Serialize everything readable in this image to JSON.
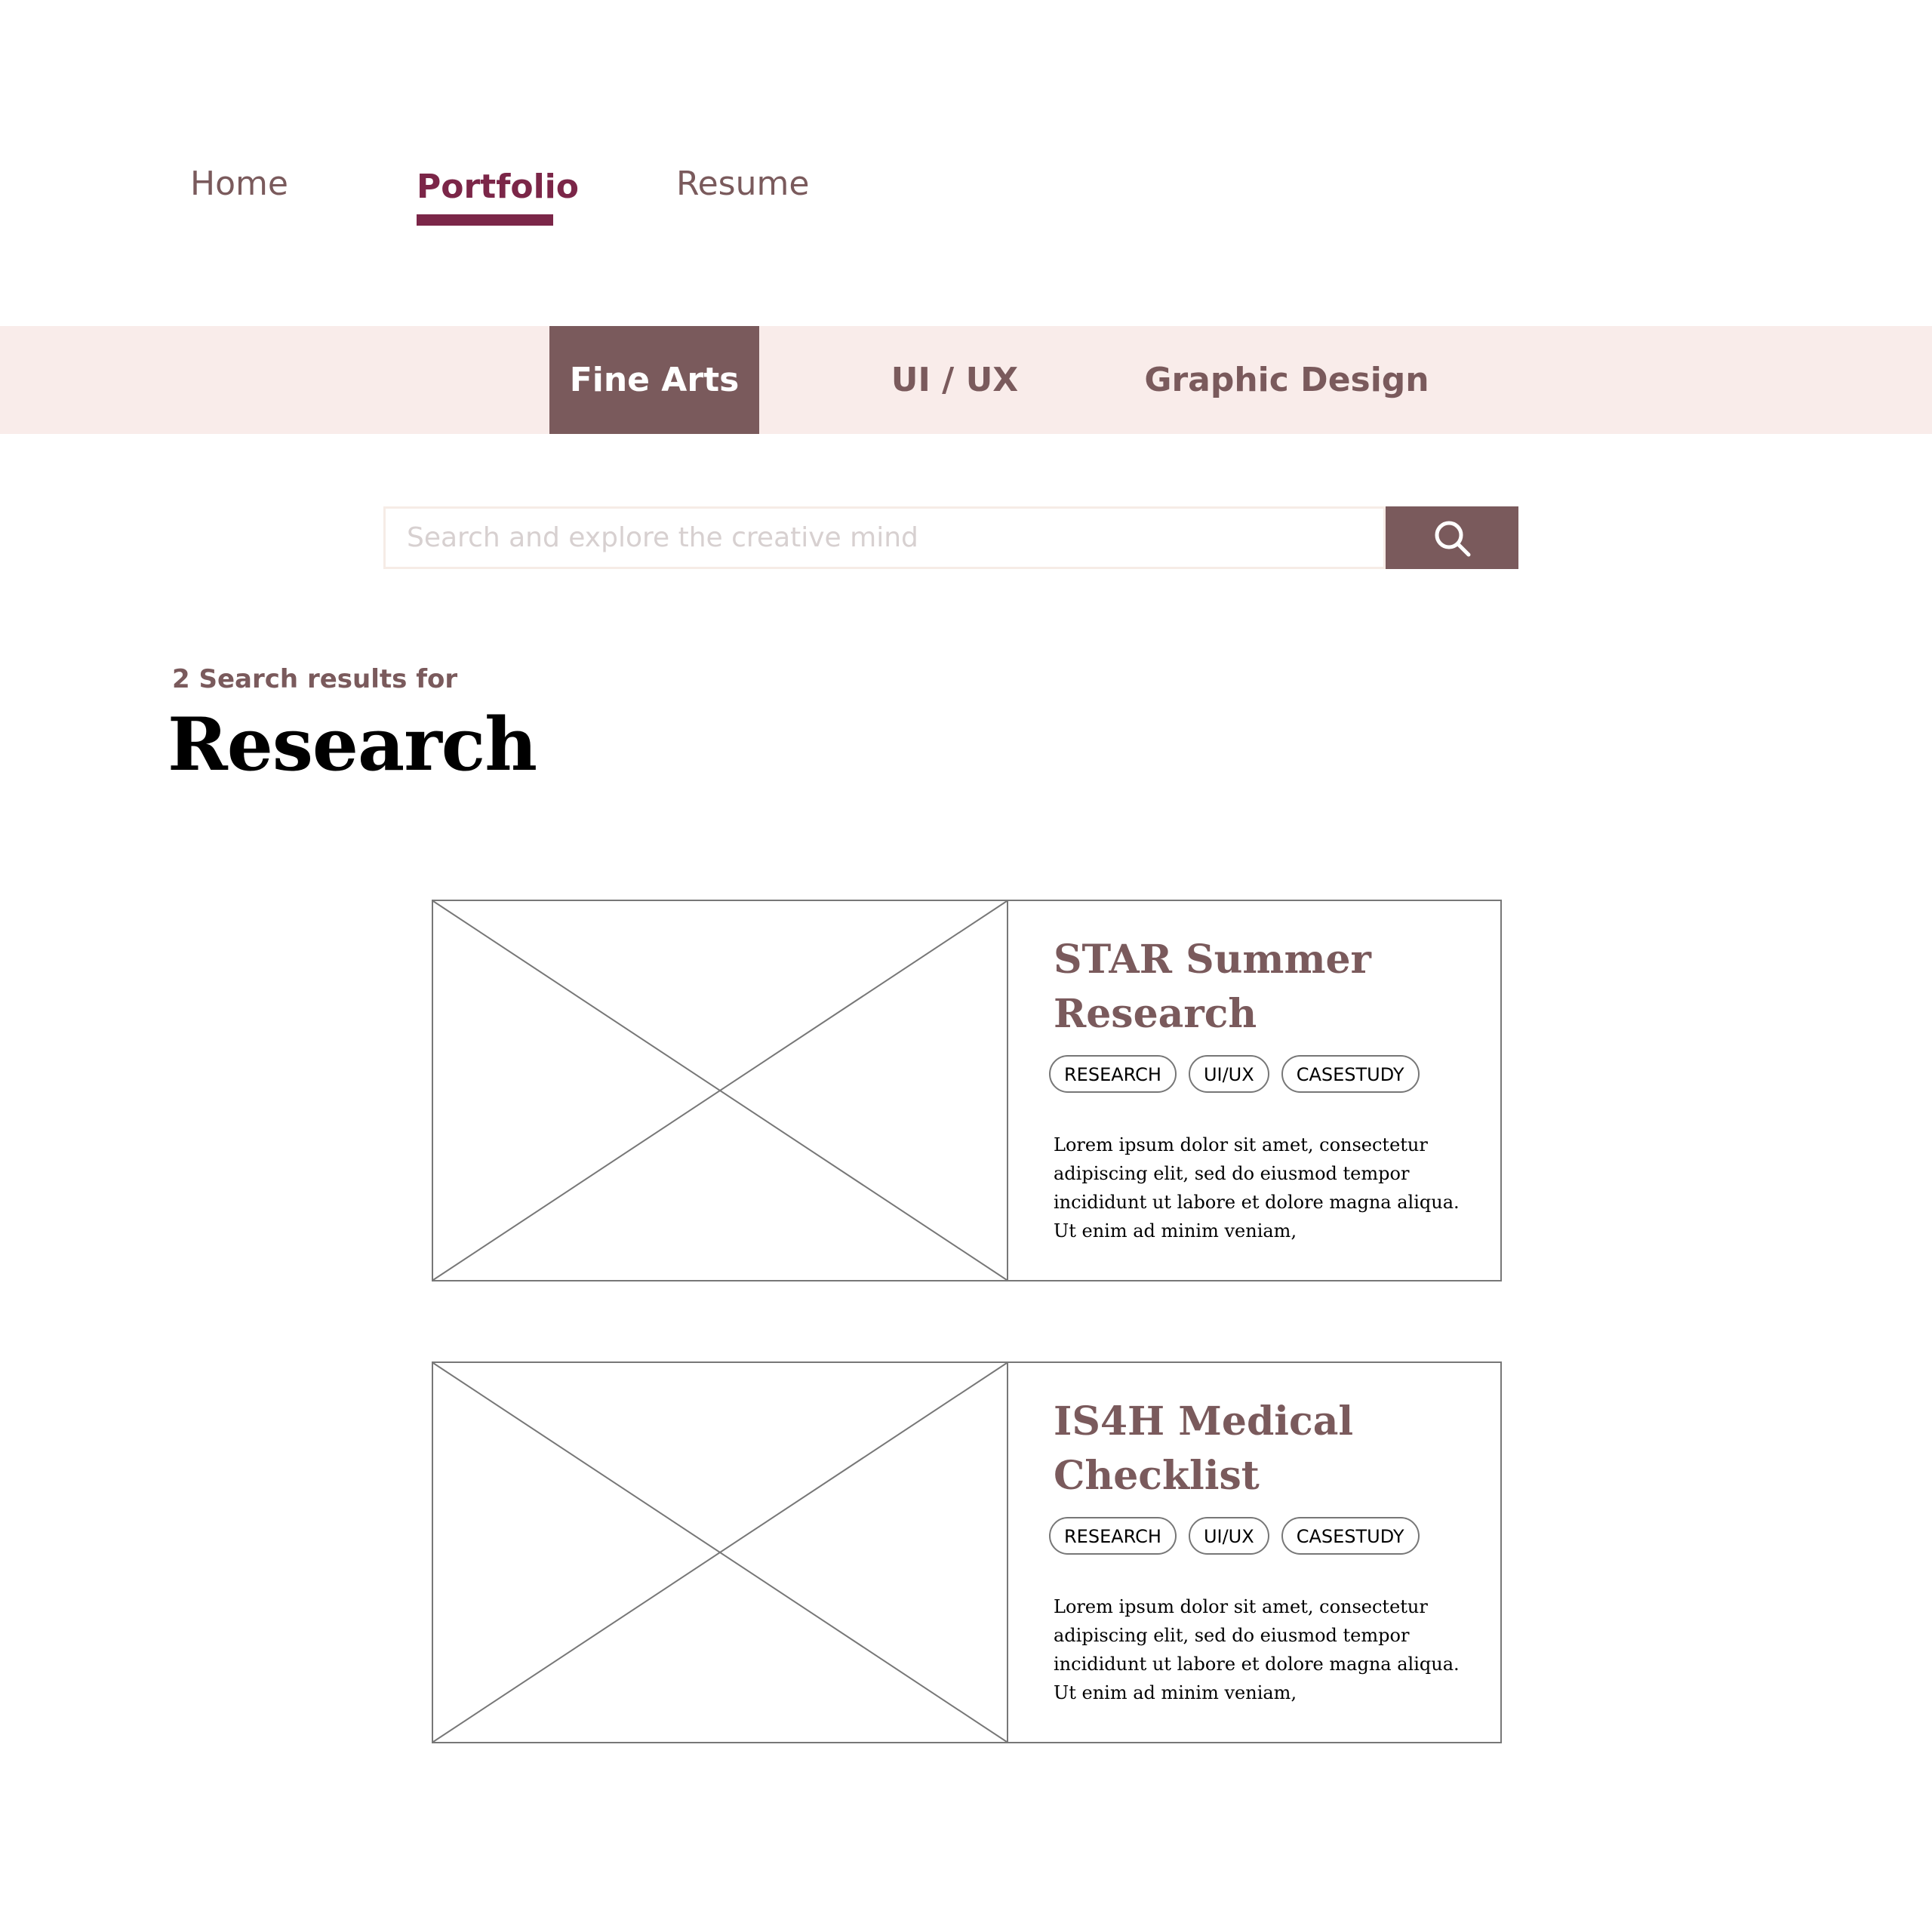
{
  "topnav": {
    "items": [
      {
        "label": "Home"
      },
      {
        "label": "Portfolio"
      },
      {
        "label": "Resume"
      }
    ],
    "active": "Portfolio",
    "accent_color": "#7b2648"
  },
  "categories": {
    "tabs": [
      {
        "label": "Fine Arts"
      },
      {
        "label": "UI / UX"
      },
      {
        "label": "Graphic Design"
      }
    ],
    "active": "Fine Arts",
    "bar_color": "#f9ecea",
    "active_color": "#7a5a5c"
  },
  "search": {
    "placeholder": "Search and explore the creative mind",
    "value": "",
    "button_icon": "search-icon"
  },
  "results": {
    "count_label": "2 Search results for",
    "query": "Research",
    "items": [
      {
        "title": "STAR Summer Research",
        "thumbnail": "image-placeholder-icon",
        "tags": [
          "RESEARCH",
          "UI/UX",
          "CASESTUDY"
        ],
        "description": "Lorem ipsum dolor sit amet, consectetur adipiscing elit, sed do eiusmod tempor incididunt ut labore et dolore magna aliqua. Ut enim ad minim veniam,"
      },
      {
        "title": "IS4H Medical Checklist",
        "thumbnail": "image-placeholder-icon",
        "tags": [
          "RESEARCH",
          "UI/UX",
          "CASESTUDY"
        ],
        "description": "Lorem ipsum dolor sit amet, consectetur adipiscing elit, sed do eiusmod tempor incididunt ut labore et dolore magna aliqua. Ut enim ad minim veniam,"
      }
    ]
  },
  "colors": {
    "primary_text": "#7a5a5c",
    "border": "#777777"
  }
}
